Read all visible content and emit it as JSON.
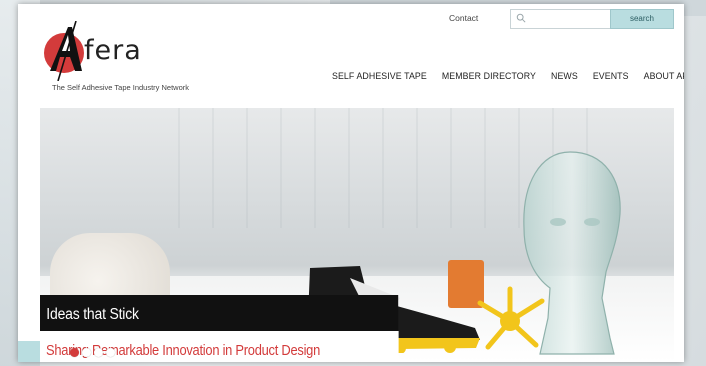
{
  "header": {
    "logo_text": "fera",
    "logo_letter": "A",
    "tagline": "The Self Adhesive Tape Industry Network",
    "contact_label": "Contact",
    "search": {
      "placeholder": "",
      "button_label": "search"
    }
  },
  "nav": {
    "items": [
      {
        "label": "SELF ADHESIVE TAPE"
      },
      {
        "label": "MEMBER DIRECTORY"
      },
      {
        "label": "NEWS"
      },
      {
        "label": "EVENTS"
      },
      {
        "label": "ABOUT AFERA"
      }
    ]
  },
  "hero": {
    "title": "Ideas that Stick",
    "subtitle": "Sharing Remarkable Innovation in Product Design",
    "slides": [
      {
        "active": true
      },
      {
        "active": false
      },
      {
        "active": false
      },
      {
        "active": false
      }
    ]
  },
  "colors": {
    "accent_red": "#d33b3b",
    "teal": "#b9dde0",
    "black": "#111111"
  }
}
